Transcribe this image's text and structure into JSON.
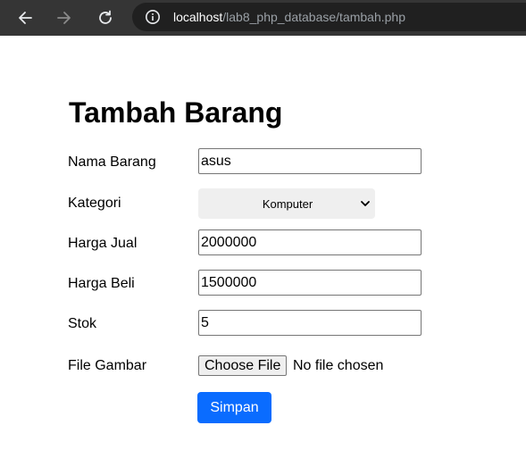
{
  "browser": {
    "url_host": "localhost",
    "url_path": "/lab8_php_database/tambah.php",
    "icons": [
      "back-arrow-icon",
      "forward-arrow-icon",
      "reload-icon",
      "info-icon"
    ]
  },
  "page": {
    "title": "Tambah Barang"
  },
  "form": {
    "nama_barang": {
      "label": "Nama Barang",
      "value": "asus"
    },
    "kategori": {
      "label": "Kategori",
      "selected": "Komputer"
    },
    "harga_jual": {
      "label": "Harga Jual",
      "value": "2000000"
    },
    "harga_beli": {
      "label": "Harga Beli",
      "value": "1500000"
    },
    "stok": {
      "label": "Stok",
      "value": "5"
    },
    "file_gambar": {
      "label": "File Gambar",
      "button": "Choose File",
      "status": "No file chosen"
    },
    "submit_label": "Simpan"
  },
  "colors": {
    "toolbar_bg": "#353535",
    "omnibox_bg": "#202020",
    "submit_bg": "#0a6cff"
  }
}
